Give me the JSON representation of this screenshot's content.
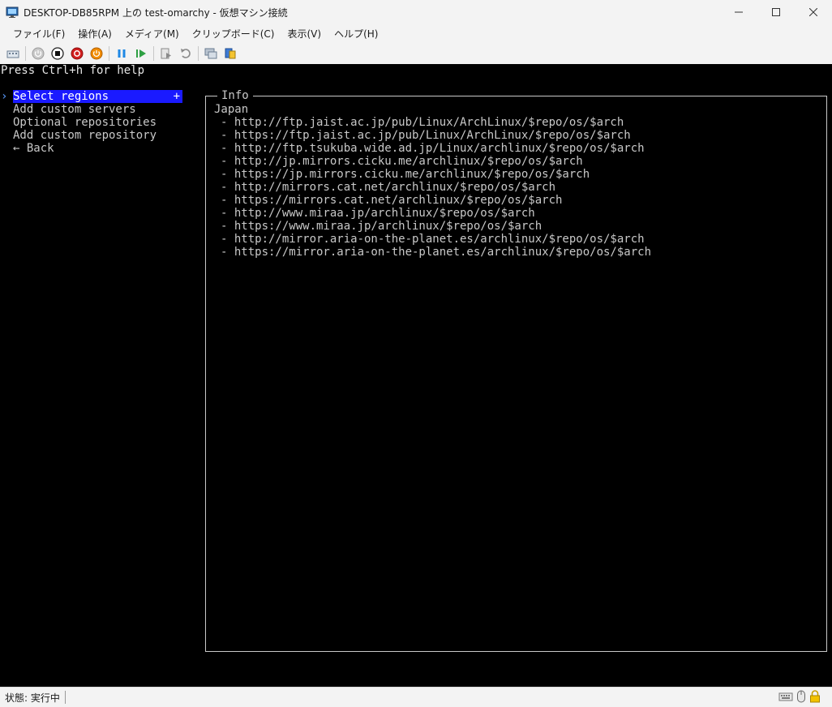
{
  "window": {
    "title": "DESKTOP-DB85RPM 上の test-omarchy  - 仮想マシン接続",
    "controls": [
      "minimize",
      "maximize",
      "close"
    ]
  },
  "menu": [
    "ファイル(F)",
    "操作(A)",
    "メディア(M)",
    "クリップボード(C)",
    "表示(V)",
    "ヘルプ(H)"
  ],
  "toolbar": {
    "icons": [
      "ctrl-alt-del-icon",
      "start-icon",
      "turn-off-icon",
      "shutdown-icon",
      "save-icon",
      "pause-icon",
      "resume-icon",
      "checkpoint-icon",
      "revert-icon",
      "enhanced-session-icon",
      "share-icon"
    ]
  },
  "console": {
    "help": "Press Ctrl+h for help",
    "cursor": "›",
    "menu_items": [
      {
        "label": "Select regions",
        "selected": true,
        "suffix": "+"
      },
      {
        "label": "Add custom servers",
        "selected": false,
        "suffix": ""
      },
      {
        "label": "Optional repositories",
        "selected": false,
        "suffix": ""
      },
      {
        "label": "Add custom repository",
        "selected": false,
        "suffix": ""
      },
      {
        "label": "← Back",
        "selected": false,
        "suffix": ""
      }
    ],
    "info": {
      "title": "Info",
      "region": "Japan",
      "mirrors": [
        "- http://ftp.jaist.ac.jp/pub/Linux/ArchLinux/$repo/os/$arch",
        "- https://ftp.jaist.ac.jp/pub/Linux/ArchLinux/$repo/os/$arch",
        "- http://ftp.tsukuba.wide.ad.jp/Linux/archlinux/$repo/os/$arch",
        "- http://jp.mirrors.cicku.me/archlinux/$repo/os/$arch",
        "- https://jp.mirrors.cicku.me/archlinux/$repo/os/$arch",
        "- http://mirrors.cat.net/archlinux/$repo/os/$arch",
        "- https://mirrors.cat.net/archlinux/$repo/os/$arch",
        "- http://www.miraa.jp/archlinux/$repo/os/$arch",
        "- https://www.miraa.jp/archlinux/$repo/os/$arch",
        "- http://mirror.aria-on-the-planet.es/archlinux/$repo/os/$arch",
        "- https://mirror.aria-on-the-planet.es/archlinux/$repo/os/$arch"
      ]
    }
  },
  "status": {
    "text": "状態: 実行中",
    "icons": [
      "keyboard-icon",
      "mouse-icon",
      "lock-icon"
    ]
  },
  "colors": {
    "selection": "#1a1aff",
    "console_bg": "#000000",
    "console_fg": "#c8c8c8"
  }
}
